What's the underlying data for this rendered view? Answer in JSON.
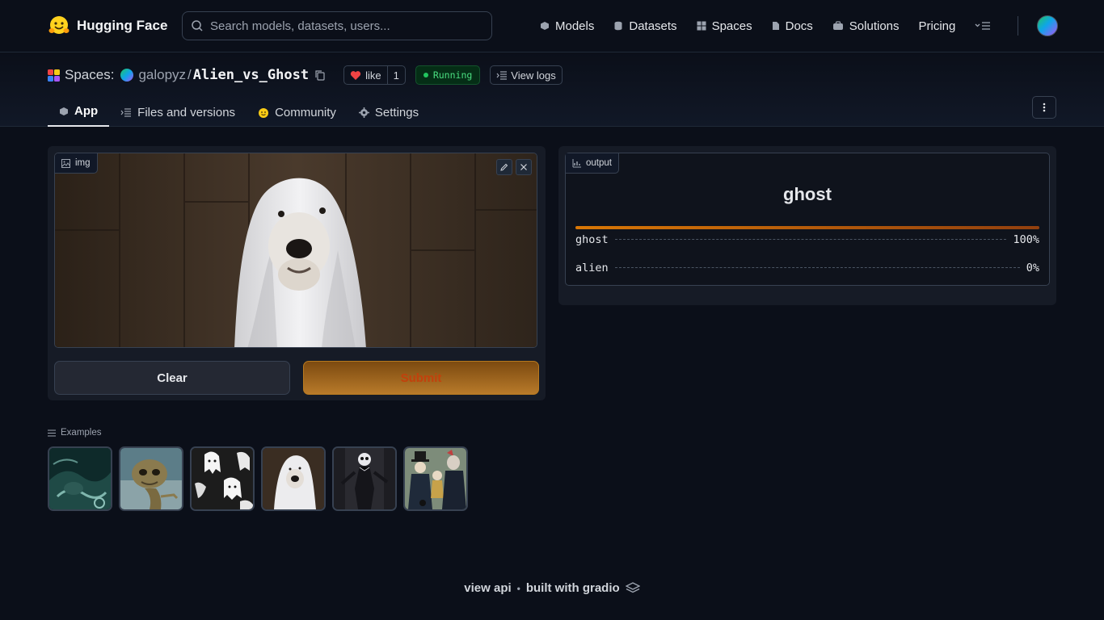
{
  "nav": {
    "brand": "Hugging Face",
    "search_placeholder": "Search models, datasets, users...",
    "links": {
      "models": "Models",
      "datasets": "Datasets",
      "spaces": "Spaces",
      "docs": "Docs",
      "solutions": "Solutions",
      "pricing": "Pricing"
    }
  },
  "space": {
    "spaces_label": "Spaces:",
    "owner": "galopyz",
    "slash": "/",
    "repo": "Alien_vs_Ghost",
    "like_label": "like",
    "like_count": "1",
    "status": "Running",
    "view_logs": "View logs",
    "tabs": {
      "app": "App",
      "files": "Files and versions",
      "community": "Community",
      "settings": "Settings"
    }
  },
  "input": {
    "label": "img",
    "clear": "Clear",
    "submit": "Submit"
  },
  "output": {
    "label": "output",
    "predicted": "ghost",
    "confidence_fraction": 1.0,
    "confidences": [
      {
        "label": "ghost",
        "value": "100%"
      },
      {
        "label": "alien",
        "value": "0%"
      }
    ]
  },
  "examples": {
    "label": "Examples"
  },
  "footer": {
    "view_api": "view api",
    "separator": "•",
    "built_with": "built with gradio"
  },
  "colors": {
    "background": "#0b0f19",
    "accent_orange": "#d97706",
    "status_green": "#22c55e",
    "heart_red": "#ef4444"
  },
  "icons": [
    "hugging-face-logo",
    "search-icon",
    "models-icon",
    "datasets-icon",
    "spaces-icon",
    "docs-icon",
    "solutions-icon",
    "menu-icon",
    "copy-icon",
    "heart-icon",
    "logs-icon",
    "files-icon",
    "community-icon",
    "gear-icon",
    "kebab-icon",
    "image-icon",
    "edit-icon",
    "close-icon",
    "chart-icon",
    "list-icon",
    "gradio-logo"
  ]
}
